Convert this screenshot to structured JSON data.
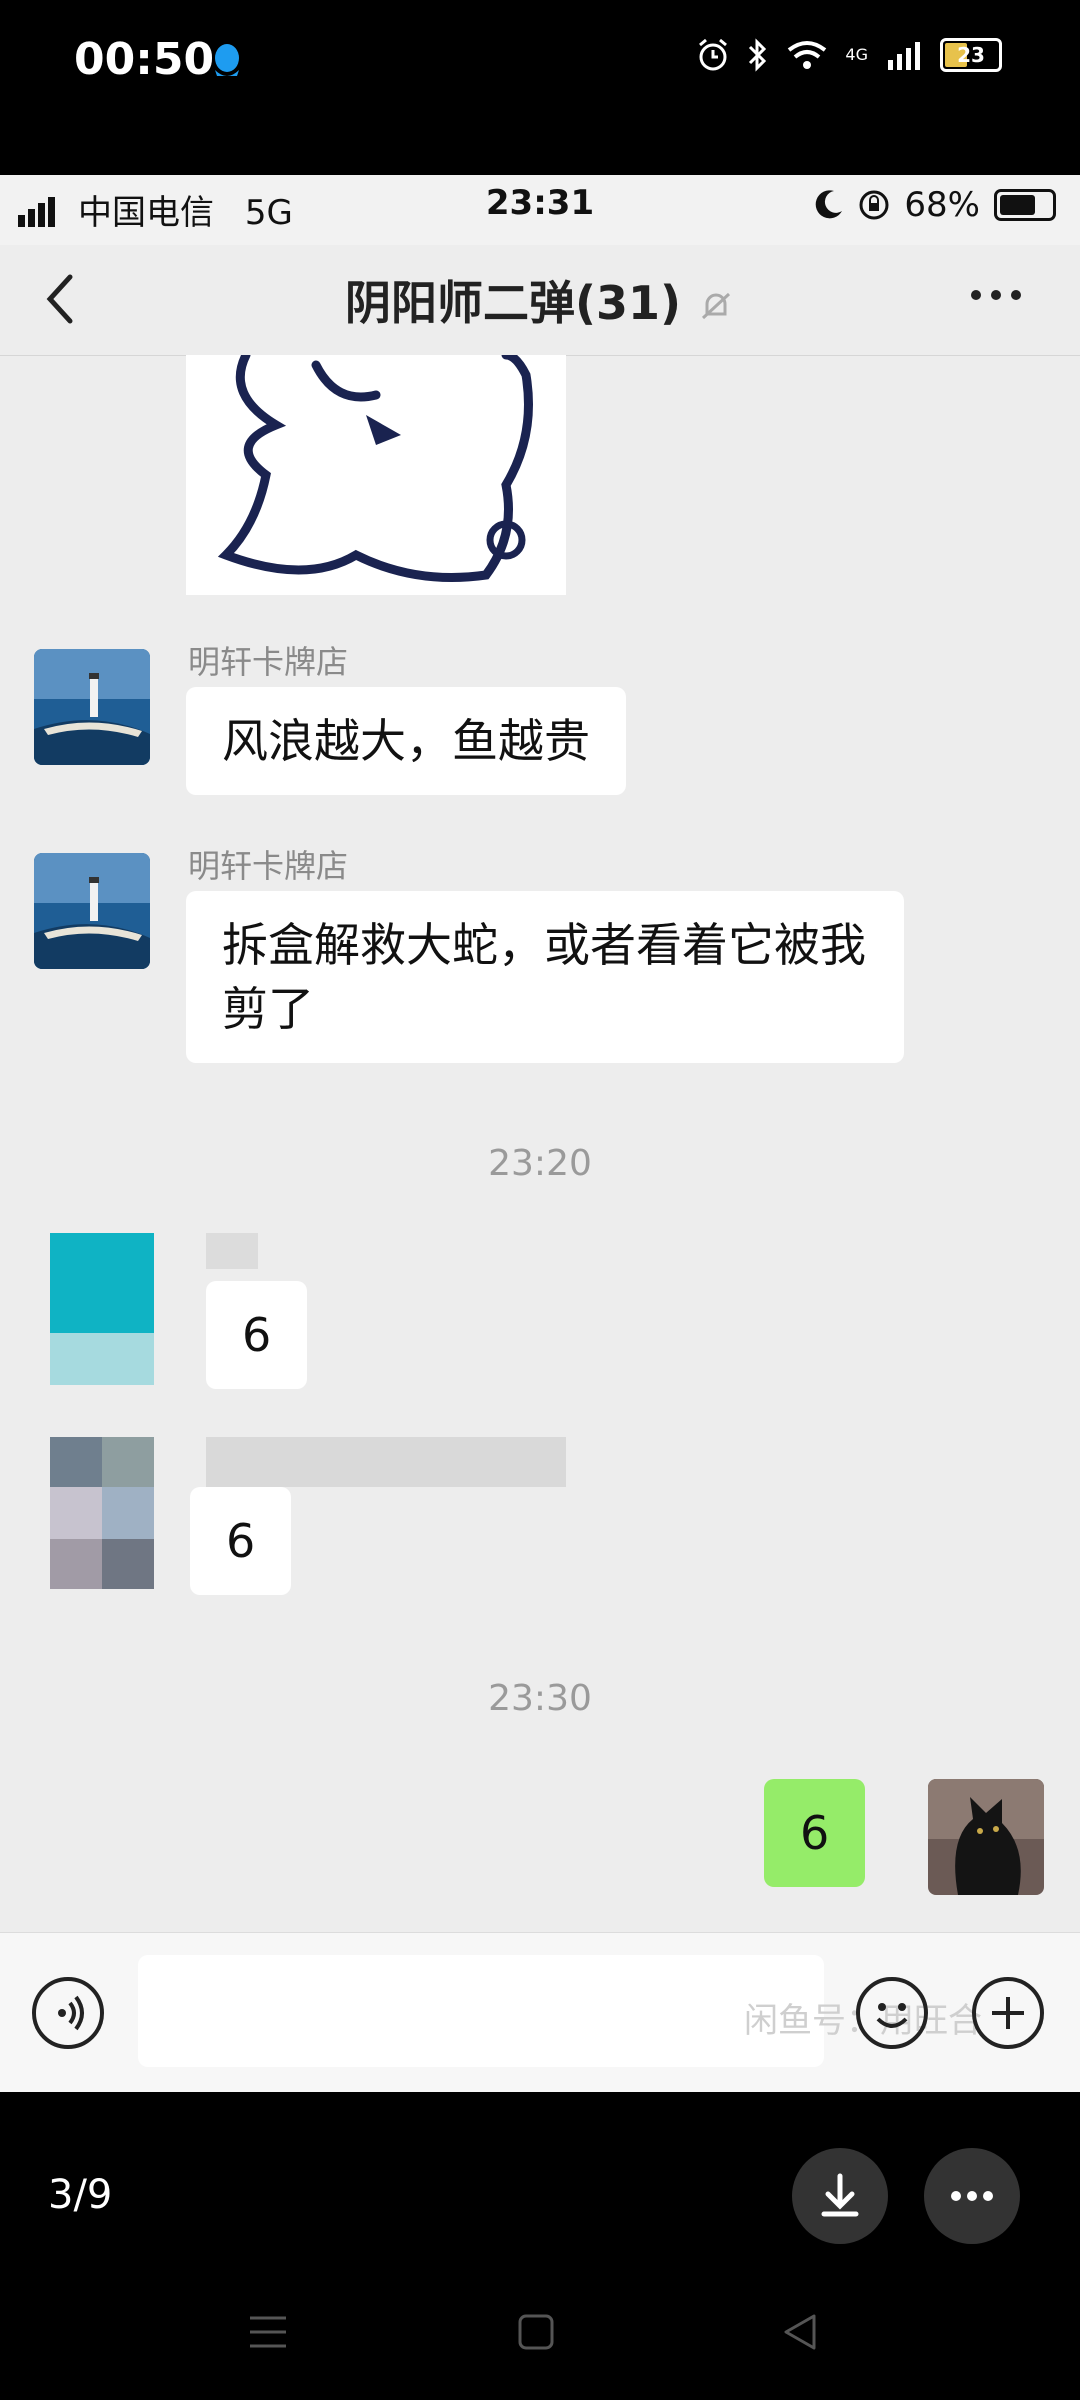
{
  "outer_status": {
    "time": "00:50",
    "battery": "23",
    "network": "4G"
  },
  "inner_status": {
    "carrier": "中国电信",
    "network": "5G",
    "time": "23:31",
    "battery": "68%"
  },
  "chat": {
    "title": "阴阳师二弹(31)"
  },
  "messages": [
    {
      "sender": "明轩卡牌店",
      "text": "风浪越大，鱼越贵"
    },
    {
      "sender": "明轩卡牌店",
      "text": "拆盒解救大蛇，或者看着它被我剪了"
    }
  ],
  "timestamps": [
    "23:20",
    "23:30"
  ],
  "blurred_messages": [
    {
      "text": "6"
    },
    {
      "text": "6"
    }
  ],
  "my_message": {
    "text": "6"
  },
  "input": {
    "watermark": "闲鱼号：用旺合"
  },
  "viewer": {
    "page": "3/9"
  },
  "colors": {
    "own_bubble": "#95ec69",
    "chat_bg": "#ededed",
    "accent_qq": "#1e9cf0"
  }
}
